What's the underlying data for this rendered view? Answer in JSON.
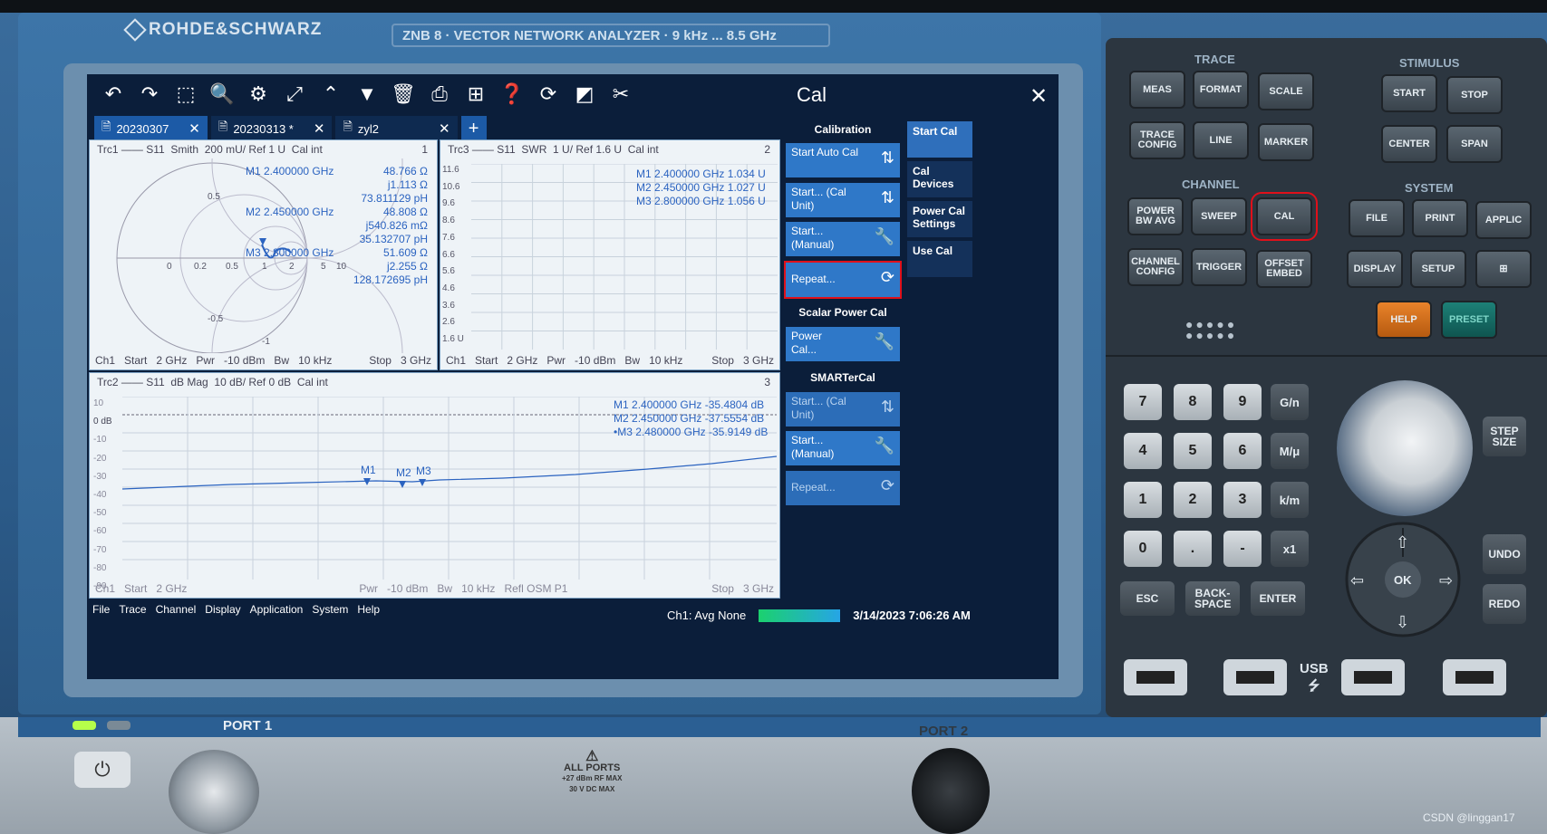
{
  "brand": {
    "name": "ROHDE&SCHWARZ",
    "model": "ZNB 8 · VECTOR NETWORK ANALYZER · 9 kHz ... 8.5 GHz"
  },
  "toolbar_icons": [
    "undo-icon",
    "redo-icon",
    "zoom-box-icon",
    "zoom-icon",
    "zoom-settings-icon",
    "fit-icon",
    "trace-add-icon",
    "marker-add-icon",
    "delete-icon",
    "print-icon",
    "windows-icon",
    "help-icon",
    "refresh-icon",
    "fullscreen-icon",
    "touch-icon"
  ],
  "tabs": [
    {
      "label": "20230307",
      "active": true
    },
    {
      "label": "20230313 *",
      "active": false
    },
    {
      "label": "zyl2",
      "active": false
    }
  ],
  "trc1": {
    "header": [
      "Trc1",
      "S11",
      "Smith",
      "200 mU/ Ref 1 U",
      "Cal int",
      "1"
    ],
    "markers": [
      {
        "label": "M1 2.400000 GHz",
        "v1": "48.766 Ω",
        "v2": "j1.113 Ω",
        "v3": "73.811129 pH"
      },
      {
        "label": "M2 2.450000 GHz",
        "v1": "48.808 Ω",
        "v2": "j540.826 mΩ",
        "v3": "35.132707 pH"
      },
      {
        "label": "M3 2.800000 GHz",
        "v1": "51.609 Ω",
        "v2": "j2.255 Ω",
        "v3": "128.172695 pH"
      }
    ],
    "smith_labels": {
      "p05": "0.5",
      "n05": "-0.5",
      "n1": "-1",
      "r0": "0",
      "r02": "0.2",
      "r05": "0.5",
      "r1": "1",
      "r2": "2",
      "r5": "5",
      "r10": "10",
      "c0": "0"
    },
    "footer": [
      "Ch1",
      "Start",
      "2 GHz",
      "Pwr",
      "-10 dBm",
      "Bw",
      "10 kHz",
      "Stop",
      "3 GHz"
    ]
  },
  "trc3": {
    "header": [
      "Trc3",
      "S11",
      "SWR",
      "1 U/ Ref 1.6 U",
      "Cal int",
      "2"
    ],
    "yticks": [
      "11.6",
      "10.6",
      "9.6",
      "8.6",
      "7.6",
      "6.6",
      "5.6",
      "4.6",
      "3.6",
      "2.6",
      "1.6 U"
    ],
    "markers": [
      {
        "label": "M1",
        "freq": "2.400000",
        "unit": "GHz",
        "val": "1.034 U"
      },
      {
        "label": "M2",
        "freq": "2.450000",
        "unit": "GHz",
        "val": "1.027 U"
      },
      {
        "label": "M3",
        "freq": "2.800000",
        "unit": "GHz",
        "val": "1.056 U"
      }
    ],
    "footer": [
      "Ch1",
      "Start",
      "2 GHz",
      "Pwr",
      "-10 dBm",
      "Bw",
      "10 kHz",
      "Stop",
      "3 GHz"
    ]
  },
  "trc2": {
    "header": [
      "Trc2",
      "S11",
      "dB Mag",
      "10 dB/ Ref 0 dB",
      "Cal int",
      "3"
    ],
    "yticks": [
      "10",
      "0 dB",
      "-10",
      "-20",
      "-30",
      "-40",
      "-50",
      "-60",
      "-70",
      "-80",
      "-90"
    ],
    "markers": [
      {
        "label": "M1",
        "freq": "2.400000",
        "unit": "GHz",
        "val": "-35.4804 dB"
      },
      {
        "label": "M2",
        "freq": "2.450000",
        "unit": "GHz",
        "val": "-37.5554 dB"
      },
      {
        "label": "•M3",
        "freq": "2.480000",
        "unit": "GHz",
        "val": "-35.9149 dB"
      }
    ],
    "marker_tags": [
      "M1",
      "M2",
      "M3"
    ],
    "footer": [
      "Ch1",
      "Start",
      "2 GHz",
      "Pwr",
      "-10 dBm",
      "Bw",
      "10 kHz",
      "Refl OSM P1",
      "Stop",
      "3 GHz"
    ]
  },
  "cal": {
    "title": "Cal",
    "sections": {
      "calibration": "Calibration",
      "scalar": "Scalar Power Cal",
      "smarter": "SMARTerCal"
    },
    "buttons": {
      "auto": "Start Auto Cal",
      "calunit": "Start... (Cal Unit)",
      "manual": "Start... (Manual)",
      "repeat": "Repeat...",
      "power": "Power Cal...",
      "smart_calunit": "Start... (Cal Unit)",
      "smart_manual": "Start... (Manual)",
      "smart_repeat": "Repeat..."
    },
    "side_tabs": [
      "Start Cal",
      "Cal Devices",
      "Power Cal Settings",
      "Use Cal"
    ]
  },
  "menubar": [
    "File",
    "Trace",
    "Channel",
    "Display",
    "Application",
    "System",
    "Help"
  ],
  "status": {
    "avg": "Ch1: Avg None",
    "datetime": "3/14/2023 7:06:26 AM"
  },
  "hard_keys": {
    "trace_label": "TRACE",
    "stimulus_label": "STIMULUS",
    "channel_label": "CHANNEL",
    "system_label": "SYSTEM",
    "meas": "MEAS",
    "format": "FORMAT",
    "scale": "SCALE",
    "trace_config": "TRACE CONFIG",
    "line": "LINE",
    "marker": "MARKER",
    "start": "START",
    "stop": "STOP",
    "center": "CENTER",
    "span": "SPAN",
    "power_bw_avg": "POWER BW AVG",
    "sweep": "SWEEP",
    "cal": "CAL",
    "channel_config": "CHANNEL CONFIG",
    "trigger": "TRIGGER",
    "offset_embed": "OFFSET EMBED",
    "file": "FILE",
    "print": "PRINT",
    "applic": "APPLIC",
    "display": "DISPLAY",
    "setup": "SETUP",
    "help": "HELP",
    "preset": "PRESET"
  },
  "numpad": [
    "7",
    "8",
    "9",
    "G/n",
    "4",
    "5",
    "6",
    "M/μ",
    "1",
    "2",
    "3",
    "k/m",
    "0",
    ".",
    "-",
    "x1"
  ],
  "entry_keys": {
    "esc": "ESC",
    "back": "BACK-SPACE",
    "enter": "ENTER"
  },
  "nav_keys": {
    "ok": "OK",
    "step": "STEP SIZE",
    "undo": "UNDO",
    "redo": "REDO"
  },
  "usb_label": "USB",
  "ports": {
    "p1": "PORT 1",
    "p2": "PORT 2"
  },
  "warning": {
    "line1": "ALL PORTS",
    "line2": "+27 dBm RF MAX",
    "line3": "30 V DC MAX"
  },
  "credit": "CSDN @linggan17"
}
